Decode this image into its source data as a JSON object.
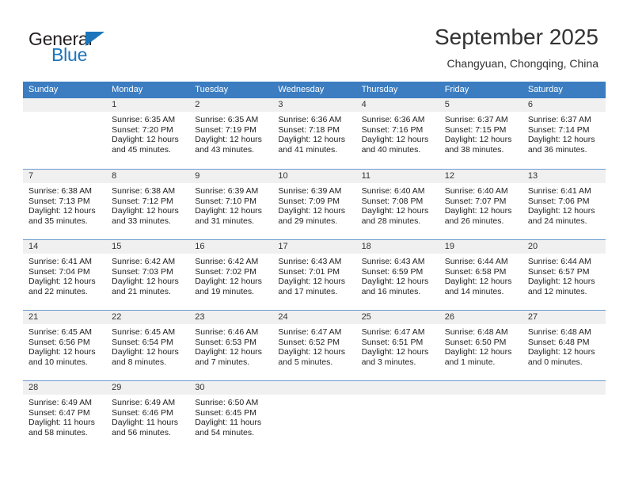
{
  "brand": {
    "name_part1": "General",
    "name_part2": "Blue",
    "accent_color": "#1b75bb"
  },
  "header": {
    "title": "September 2025",
    "subtitle": "Changyuan, Chongqing, China"
  },
  "calendar": {
    "header_bg": "#3b7dc0",
    "daynum_band_bg": "#f0f0f0",
    "weekdays": [
      "Sunday",
      "Monday",
      "Tuesday",
      "Wednesday",
      "Thursday",
      "Friday",
      "Saturday"
    ],
    "weeks": [
      [
        {
          "day": "",
          "lines": []
        },
        {
          "day": "1",
          "lines": [
            "Sunrise: 6:35 AM",
            "Sunset: 7:20 PM",
            "Daylight: 12 hours",
            "and 45 minutes."
          ]
        },
        {
          "day": "2",
          "lines": [
            "Sunrise: 6:35 AM",
            "Sunset: 7:19 PM",
            "Daylight: 12 hours",
            "and 43 minutes."
          ]
        },
        {
          "day": "3",
          "lines": [
            "Sunrise: 6:36 AM",
            "Sunset: 7:18 PM",
            "Daylight: 12 hours",
            "and 41 minutes."
          ]
        },
        {
          "day": "4",
          "lines": [
            "Sunrise: 6:36 AM",
            "Sunset: 7:16 PM",
            "Daylight: 12 hours",
            "and 40 minutes."
          ]
        },
        {
          "day": "5",
          "lines": [
            "Sunrise: 6:37 AM",
            "Sunset: 7:15 PM",
            "Daylight: 12 hours",
            "and 38 minutes."
          ]
        },
        {
          "day": "6",
          "lines": [
            "Sunrise: 6:37 AM",
            "Sunset: 7:14 PM",
            "Daylight: 12 hours",
            "and 36 minutes."
          ]
        }
      ],
      [
        {
          "day": "7",
          "lines": [
            "Sunrise: 6:38 AM",
            "Sunset: 7:13 PM",
            "Daylight: 12 hours",
            "and 35 minutes."
          ]
        },
        {
          "day": "8",
          "lines": [
            "Sunrise: 6:38 AM",
            "Sunset: 7:12 PM",
            "Daylight: 12 hours",
            "and 33 minutes."
          ]
        },
        {
          "day": "9",
          "lines": [
            "Sunrise: 6:39 AM",
            "Sunset: 7:10 PM",
            "Daylight: 12 hours",
            "and 31 minutes."
          ]
        },
        {
          "day": "10",
          "lines": [
            "Sunrise: 6:39 AM",
            "Sunset: 7:09 PM",
            "Daylight: 12 hours",
            "and 29 minutes."
          ]
        },
        {
          "day": "11",
          "lines": [
            "Sunrise: 6:40 AM",
            "Sunset: 7:08 PM",
            "Daylight: 12 hours",
            "and 28 minutes."
          ]
        },
        {
          "day": "12",
          "lines": [
            "Sunrise: 6:40 AM",
            "Sunset: 7:07 PM",
            "Daylight: 12 hours",
            "and 26 minutes."
          ]
        },
        {
          "day": "13",
          "lines": [
            "Sunrise: 6:41 AM",
            "Sunset: 7:06 PM",
            "Daylight: 12 hours",
            "and 24 minutes."
          ]
        }
      ],
      [
        {
          "day": "14",
          "lines": [
            "Sunrise: 6:41 AM",
            "Sunset: 7:04 PM",
            "Daylight: 12 hours",
            "and 22 minutes."
          ]
        },
        {
          "day": "15",
          "lines": [
            "Sunrise: 6:42 AM",
            "Sunset: 7:03 PM",
            "Daylight: 12 hours",
            "and 21 minutes."
          ]
        },
        {
          "day": "16",
          "lines": [
            "Sunrise: 6:42 AM",
            "Sunset: 7:02 PM",
            "Daylight: 12 hours",
            "and 19 minutes."
          ]
        },
        {
          "day": "17",
          "lines": [
            "Sunrise: 6:43 AM",
            "Sunset: 7:01 PM",
            "Daylight: 12 hours",
            "and 17 minutes."
          ]
        },
        {
          "day": "18",
          "lines": [
            "Sunrise: 6:43 AM",
            "Sunset: 6:59 PM",
            "Daylight: 12 hours",
            "and 16 minutes."
          ]
        },
        {
          "day": "19",
          "lines": [
            "Sunrise: 6:44 AM",
            "Sunset: 6:58 PM",
            "Daylight: 12 hours",
            "and 14 minutes."
          ]
        },
        {
          "day": "20",
          "lines": [
            "Sunrise: 6:44 AM",
            "Sunset: 6:57 PM",
            "Daylight: 12 hours",
            "and 12 minutes."
          ]
        }
      ],
      [
        {
          "day": "21",
          "lines": [
            "Sunrise: 6:45 AM",
            "Sunset: 6:56 PM",
            "Daylight: 12 hours",
            "and 10 minutes."
          ]
        },
        {
          "day": "22",
          "lines": [
            "Sunrise: 6:45 AM",
            "Sunset: 6:54 PM",
            "Daylight: 12 hours",
            "and 8 minutes."
          ]
        },
        {
          "day": "23",
          "lines": [
            "Sunrise: 6:46 AM",
            "Sunset: 6:53 PM",
            "Daylight: 12 hours",
            "and 7 minutes."
          ]
        },
        {
          "day": "24",
          "lines": [
            "Sunrise: 6:47 AM",
            "Sunset: 6:52 PM",
            "Daylight: 12 hours",
            "and 5 minutes."
          ]
        },
        {
          "day": "25",
          "lines": [
            "Sunrise: 6:47 AM",
            "Sunset: 6:51 PM",
            "Daylight: 12 hours",
            "and 3 minutes."
          ]
        },
        {
          "day": "26",
          "lines": [
            "Sunrise: 6:48 AM",
            "Sunset: 6:50 PM",
            "Daylight: 12 hours",
            "and 1 minute."
          ]
        },
        {
          "day": "27",
          "lines": [
            "Sunrise: 6:48 AM",
            "Sunset: 6:48 PM",
            "Daylight: 12 hours",
            "and 0 minutes."
          ]
        }
      ],
      [
        {
          "day": "28",
          "lines": [
            "Sunrise: 6:49 AM",
            "Sunset: 6:47 PM",
            "Daylight: 11 hours",
            "and 58 minutes."
          ]
        },
        {
          "day": "29",
          "lines": [
            "Sunrise: 6:49 AM",
            "Sunset: 6:46 PM",
            "Daylight: 11 hours",
            "and 56 minutes."
          ]
        },
        {
          "day": "30",
          "lines": [
            "Sunrise: 6:50 AM",
            "Sunset: 6:45 PM",
            "Daylight: 11 hours",
            "and 54 minutes."
          ]
        },
        {
          "day": "",
          "lines": []
        },
        {
          "day": "",
          "lines": []
        },
        {
          "day": "",
          "lines": []
        },
        {
          "day": "",
          "lines": []
        }
      ]
    ]
  }
}
